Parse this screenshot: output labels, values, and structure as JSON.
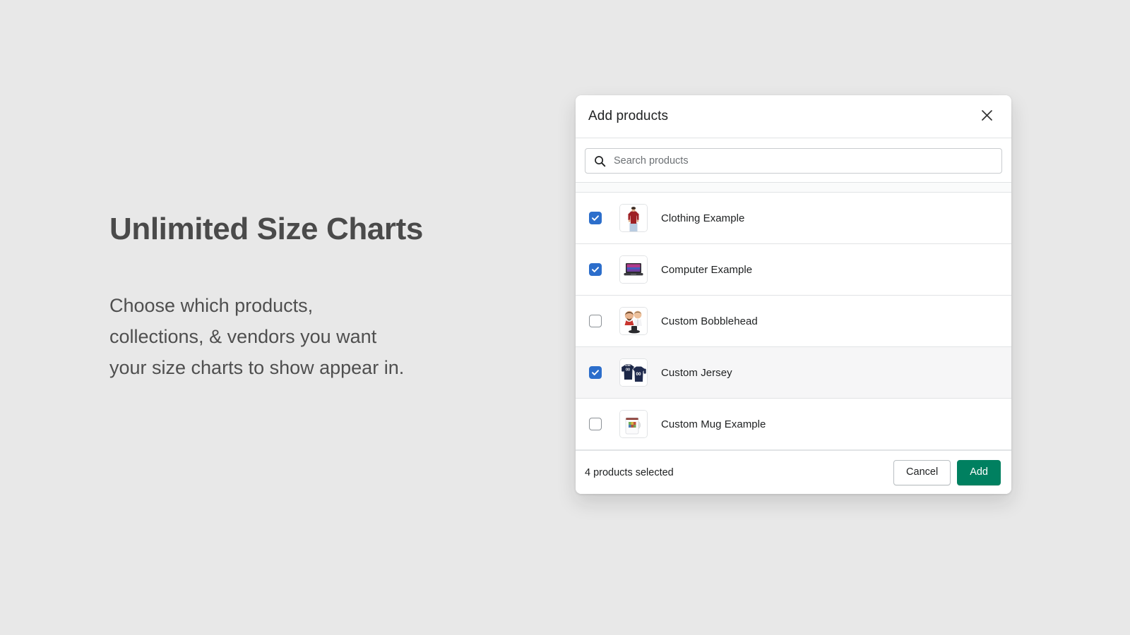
{
  "promo": {
    "title": "Unlimited Size Charts",
    "body_lines": [
      "Choose which products,",
      "collections, & vendors you want",
      "your size charts to show appear in."
    ]
  },
  "modal": {
    "title": "Add products",
    "close_icon": "close-icon",
    "search": {
      "icon": "search-icon",
      "value": "",
      "placeholder": "Search products"
    },
    "products": [
      {
        "name": "Clothing Example",
        "checked": true,
        "hovered": false,
        "thumb": "tshirt-thumbnail"
      },
      {
        "name": "Computer Example",
        "checked": true,
        "hovered": false,
        "thumb": "laptop-thumbnail"
      },
      {
        "name": "Custom Bobblehead",
        "checked": false,
        "hovered": false,
        "thumb": "bobblehead-thumbnail"
      },
      {
        "name": "Custom Jersey",
        "checked": true,
        "hovered": true,
        "thumb": "jersey-thumbnail"
      },
      {
        "name": "Custom Mug Example",
        "checked": false,
        "hovered": false,
        "thumb": "mug-thumbnail"
      }
    ],
    "footer": {
      "selected_count_label": "4 products selected",
      "cancel_label": "Cancel",
      "add_label": "Add"
    }
  },
  "colors": {
    "page_background": "#e8e8e8",
    "modal_background": "#ffffff",
    "checkbox_checked": "#2c6ecb",
    "primary_button": "#008060",
    "row_hover": "#f6f6f7",
    "border": "#e1e3e5",
    "text": "#202223",
    "muted_text": "#6d7175"
  }
}
